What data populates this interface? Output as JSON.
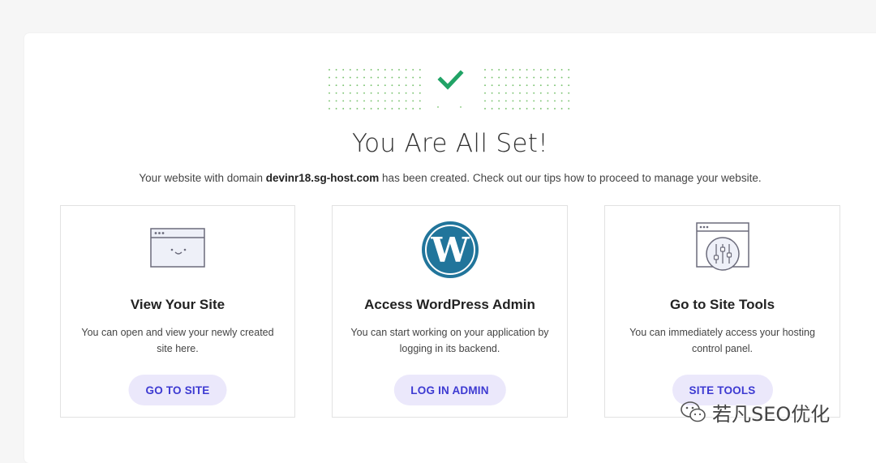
{
  "page": {
    "title": "You Are All Set!",
    "subtitle_prefix": "Your website with domain ",
    "domain": "devinr18.sg-host.com",
    "subtitle_suffix": " has been created. Check out our tips how to proceed to manage your website."
  },
  "cards": [
    {
      "icon": "browser-smiley-icon",
      "title": "View Your Site",
      "description": "You can open and view your newly created site here.",
      "button": "GO TO SITE"
    },
    {
      "icon": "wordpress-logo-icon",
      "title": "Access WordPress Admin",
      "description": "You can start working on your application by logging in its backend.",
      "button": "LOG IN ADMIN"
    },
    {
      "icon": "site-tools-sliders-icon",
      "title": "Go to Site Tools",
      "description": "You can immediately access your hosting control panel.",
      "button": "SITE TOOLS"
    }
  ],
  "watermark": {
    "text": "若凡SEO优化",
    "icon": "wechat-icon"
  },
  "colors": {
    "accent_button_bg": "#ebe8fb",
    "accent_button_text": "#3d3ad2",
    "success_green": "#21a366",
    "wordpress_blue": "#21759b"
  }
}
